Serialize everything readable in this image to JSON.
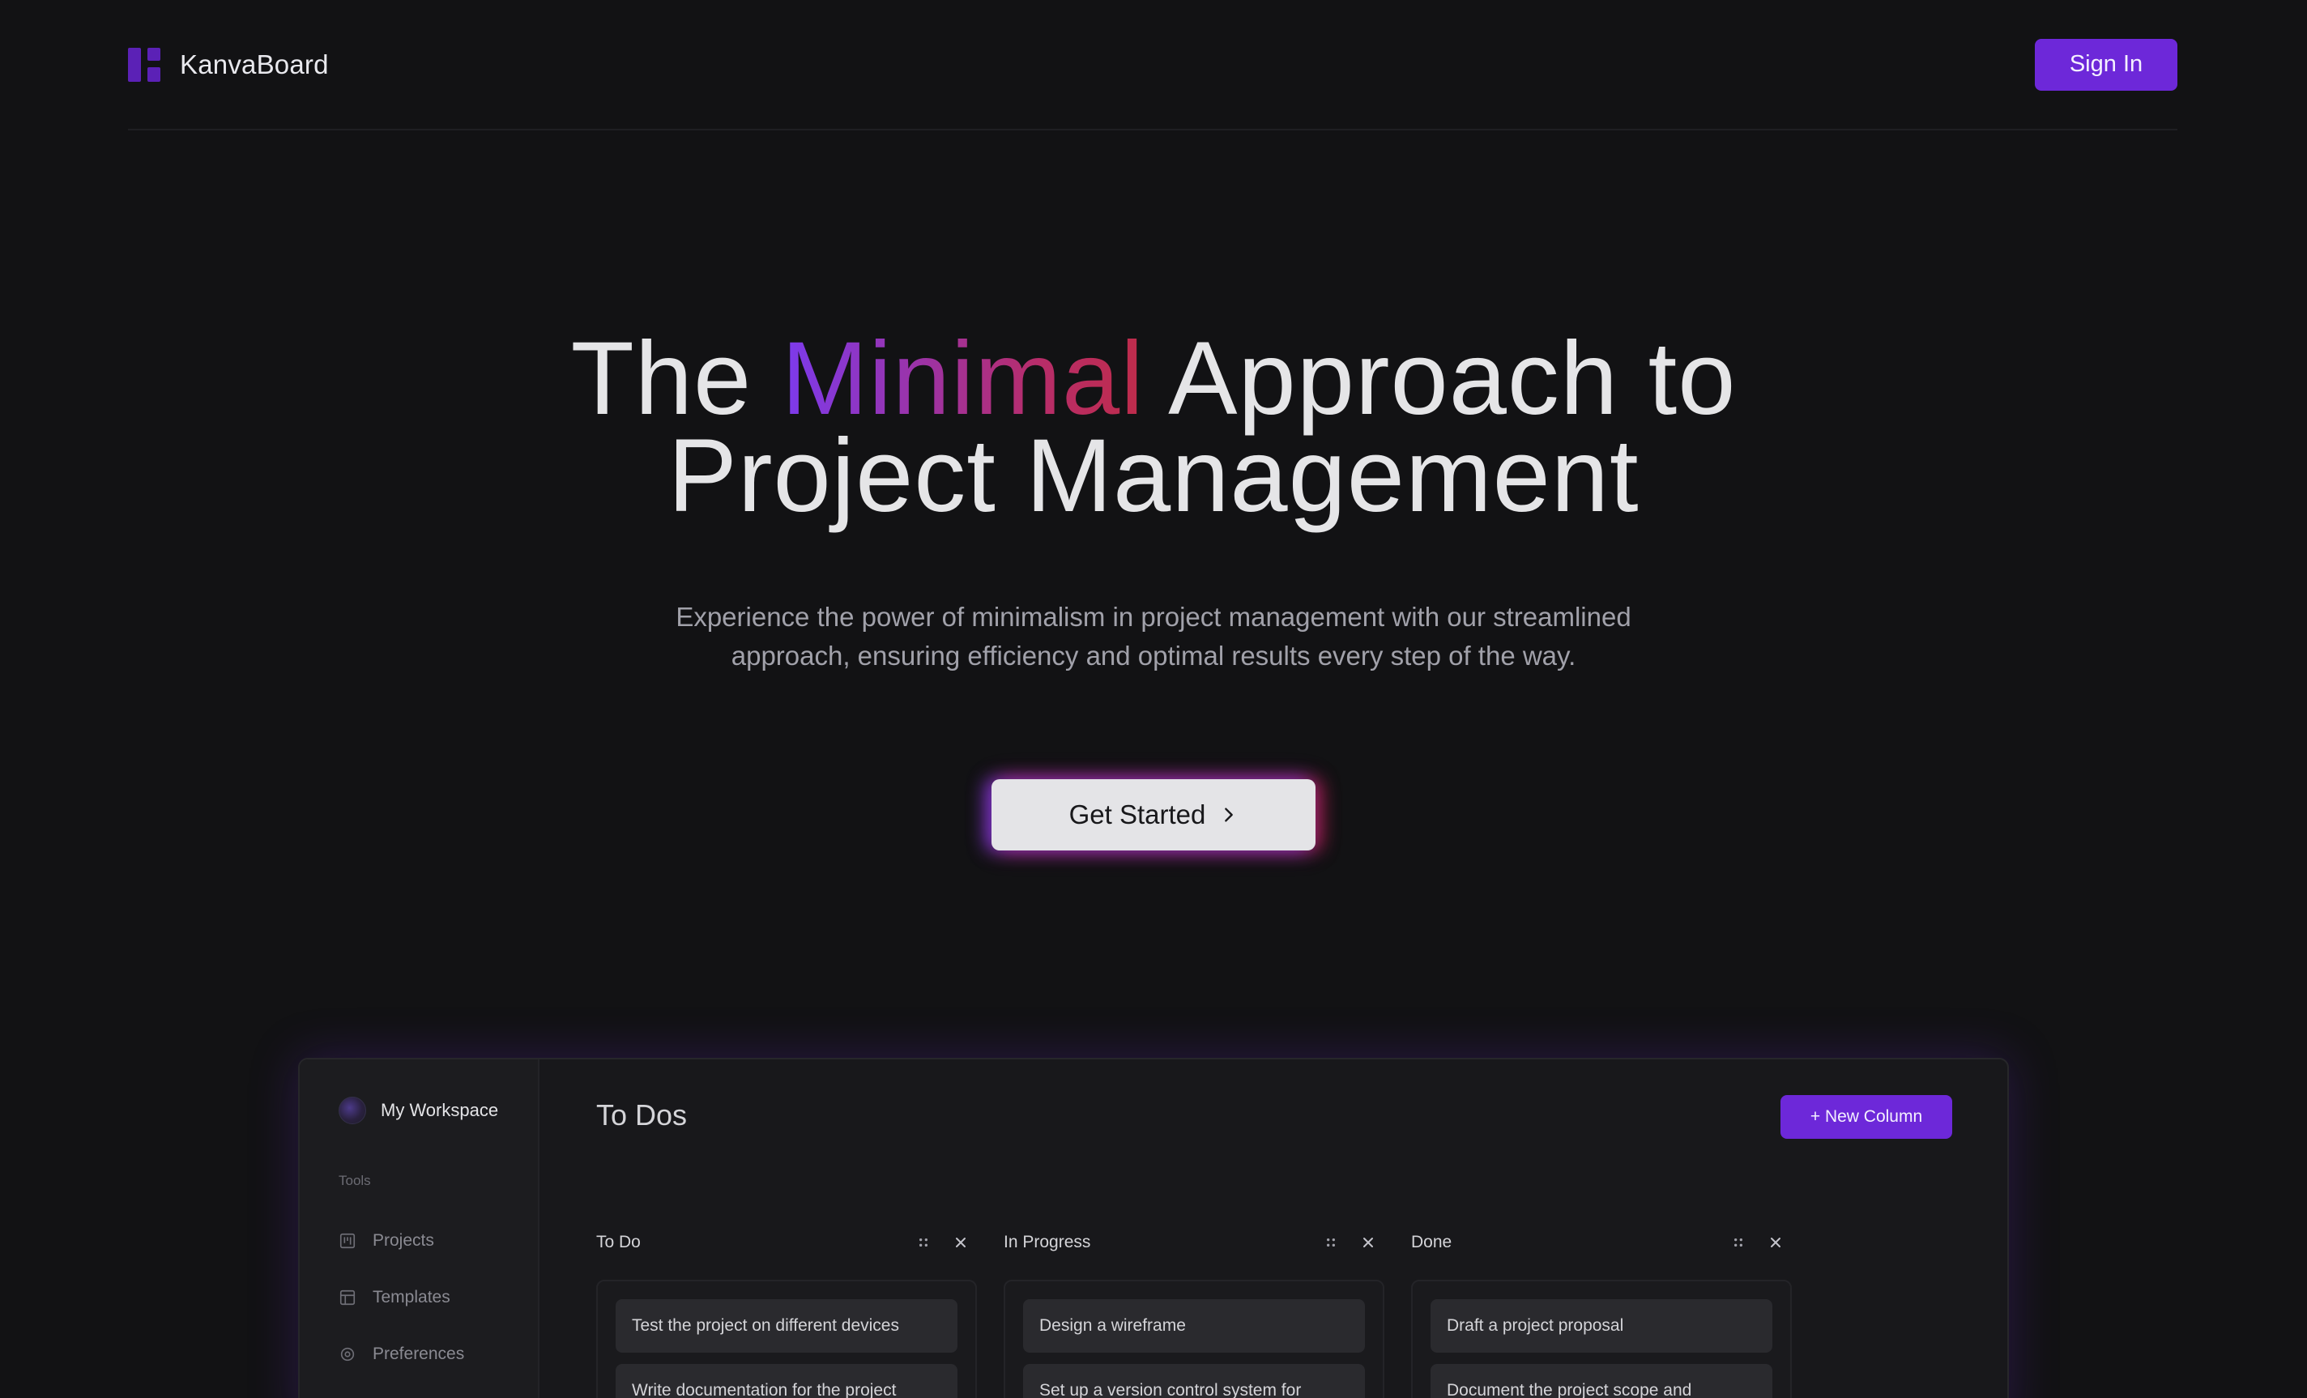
{
  "header": {
    "brand": "KanvaBoard",
    "sign_in": "Sign In"
  },
  "hero": {
    "title_before": "The ",
    "title_accent": "Minimal",
    "title_after": " Approach to",
    "title_line2": "Project Management",
    "subtitle_line1": "Experience the power of minimalism in project management with our streamlined",
    "subtitle_line2": "approach, ensuring efficiency and optimal results every step of the way.",
    "cta": "Get Started"
  },
  "preview": {
    "workspace": "My Workspace",
    "tools_label": "Tools",
    "nav": [
      {
        "label": "Projects",
        "icon": "projects-icon"
      },
      {
        "label": "Templates",
        "icon": "templates-icon"
      },
      {
        "label": "Preferences",
        "icon": "preferences-icon"
      }
    ],
    "title": "To Dos",
    "new_column": "+ New Column",
    "columns": [
      {
        "title": "To Do",
        "cards": [
          "Test the project on different devices",
          "Write documentation for the project"
        ]
      },
      {
        "title": "In Progress",
        "cards": [
          "Design a wireframe",
          "Set up a version control system for"
        ]
      },
      {
        "title": "Done",
        "cards": [
          "Draft a project proposal",
          "Document the project scope and"
        ]
      }
    ]
  },
  "colors": {
    "background": "#121214",
    "accent": "#6d28d9",
    "gradient_start": "#7c3aed",
    "gradient_end": "#be2c4a"
  }
}
